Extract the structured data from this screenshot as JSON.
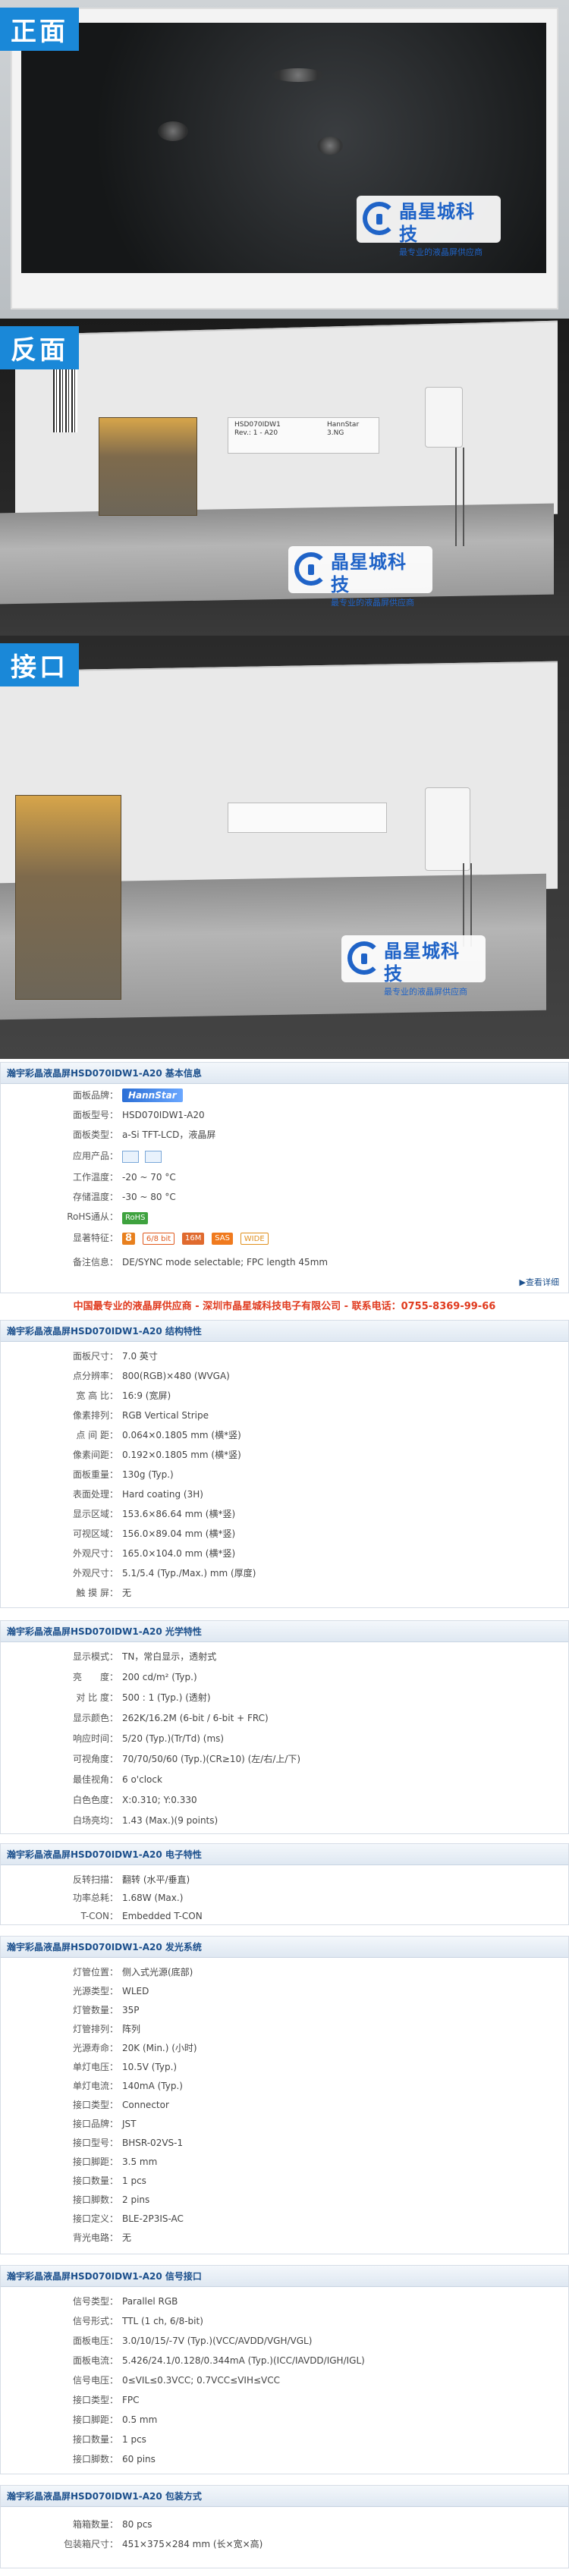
{
  "photos": {
    "front": {
      "tag": "正面"
    },
    "back": {
      "tag": "反面",
      "sticker_lines": [
        "HSD070IDW1",
        "Rev.: 1 - A20",
        "HannStar",
        "3.NG"
      ]
    },
    "port": {
      "tag": "接口"
    }
  },
  "logo": {
    "name": "晶星城科技",
    "slogan": "最专业的液晶屏供应商"
  },
  "basic": {
    "title": "瀚宇彩晶液晶屏HSD070IDW1-A20 基本信息",
    "brand_label": "面板品牌：",
    "brand_value": "HannStar",
    "model_label": "面板型号：",
    "model_value": "HSD070IDW1-A20",
    "type_label": "面板类型：",
    "type_value": "a-Si TFT-LCD，液晶屏",
    "app_label": "应用产品：",
    "optemp_label": "工作温度：",
    "optemp_value": "-20 ~ 70 °C",
    "sttemp_label": "存储温度：",
    "sttemp_value": "-30 ~ 80 °C",
    "rohs_label": "RoHS通从：",
    "rohs_value": "RoHS",
    "feature_label": "显著特征：",
    "features": [
      "8",
      "6/8 bit",
      "16M",
      "SAS",
      "WIDE"
    ],
    "remark_label": "备注信息：",
    "remark_value": "DE/SYNC mode selectable; FPC length 45mm",
    "more_link": "▶查看详细"
  },
  "banner": "中国最专业的液晶屏供应商 - 深圳市晶星城科技电子有限公司 - 联系电话：0755-8369-99-66",
  "structure": {
    "title": "瀚宇彩晶液晶屏HSD070IDW1-A20 结构特性",
    "rows": [
      [
        "面板尺寸：",
        "7.0 英寸"
      ],
      [
        "点分辨率：",
        "800(RGB)×480 (WVGA)"
      ],
      [
        "宽 高 比：",
        "16:9 (宽屏)"
      ],
      [
        "像素排列：",
        "RGB Vertical Stripe"
      ],
      [
        "点 间 距：",
        "0.064×0.1805 mm (横*竖)"
      ],
      [
        "像素间距：",
        "0.192×0.1805 mm (横*竖)"
      ],
      [
        "面板重量：",
        "130g (Typ.)"
      ],
      [
        "表面处理：",
        "Hard coating (3H)"
      ],
      [
        "显示区域：",
        "153.6×86.64 mm (横*竖)"
      ],
      [
        "可视区域：",
        "156.0×89.04 mm (横*竖)"
      ],
      [
        "外观尺寸：",
        "165.0×104.0 mm (横*竖)"
      ],
      [
        "外观尺寸：",
        "5.1/5.4 (Typ./Max.) mm (厚度)"
      ],
      [
        "触 摸 屏：",
        "无"
      ]
    ]
  },
  "optical": {
    "title": "瀚宇彩晶液晶屏HSD070IDW1-A20 光学特性",
    "rows": [
      [
        "显示模式：",
        "TN，常白显示，透射式"
      ],
      [
        "亮　　度：",
        "200 cd/m² (Typ.)"
      ],
      [
        "对 比 度：",
        "500 : 1 (Typ.) (透射)"
      ],
      [
        "显示颜色：",
        "262K/16.2M (6-bit / 6-bit + FRC)"
      ],
      [
        "响应时间：",
        "5/20 (Typ.)(Tr/Td) (ms)"
      ],
      [
        "可视角度：",
        "70/70/50/60 (Typ.)(CR≥10) (左/右/上/下)"
      ],
      [
        "最佳视角：",
        "6 o'clock"
      ],
      [
        "白色色度：",
        "X:0.310; Y:0.330"
      ],
      [
        "白场亮均：",
        "1.43 (Max.)(9 points)"
      ]
    ]
  },
  "electrical": {
    "title": "瀚宇彩晶液晶屏HSD070IDW1-A20 电子特性",
    "rows": [
      [
        "反转扫描：",
        "翻转 (水平/垂直)"
      ],
      [
        "功率总耗：",
        "1.68W (Max.)"
      ],
      [
        "T-CON：",
        "Embedded T-CON"
      ]
    ]
  },
  "backlight": {
    "title": "瀚宇彩晶液晶屏HSD070IDW1-A20 发光系统",
    "rows": [
      [
        "灯管位置：",
        "侧入式光源(底部)"
      ],
      [
        "光源类型：",
        "WLED"
      ],
      [
        "灯管数量：",
        "35P"
      ],
      [
        "灯管排列：",
        "阵列"
      ],
      [
        "光源寿命：",
        "20K (Min.) (小时)"
      ],
      [
        "单灯电压：",
        "10.5V (Typ.)"
      ],
      [
        "单灯电流：",
        "140mA (Typ.)"
      ],
      [
        "接口类型：",
        "Connector"
      ],
      [
        "接口品牌：",
        "JST"
      ],
      [
        "接口型号：",
        "BHSR-02VS-1"
      ],
      [
        "接口脚距：",
        "3.5 mm"
      ],
      [
        "接口数量：",
        "1 pcs"
      ],
      [
        "接口脚数：",
        "2 pins"
      ],
      [
        "接口定义：",
        "BLE-2P3IS-AC"
      ],
      [
        "背光电路：",
        "无"
      ]
    ]
  },
  "signal": {
    "title": "瀚宇彩晶液晶屏HSD070IDW1-A20 信号接口",
    "rows": [
      [
        "信号类型：",
        "Parallel RGB"
      ],
      [
        "信号形式：",
        "TTL (1 ch, 6/8-bit)"
      ],
      [
        "面板电压：",
        "3.0/10/15/-7V (Typ.)(VCC/AVDD/VGH/VGL)"
      ],
      [
        "面板电流：",
        "5.426/24.1/0.128/0.344mA (Typ.)(ICC/IAVDD/IGH/IGL)"
      ],
      [
        "信号电压：",
        "0≤VIL≤0.3VCC; 0.7VCC≤VIH≤VCC"
      ],
      [
        "接口类型：",
        "FPC"
      ],
      [
        "接口脚距：",
        "0.5 mm"
      ],
      [
        "接口数量：",
        "1 pcs"
      ],
      [
        "接口脚数：",
        "60 pins"
      ]
    ]
  },
  "package": {
    "title": "瀚宇彩晶液晶屏HSD070IDW1-A20 包装方式",
    "rows": [
      [
        "箱箱数量：",
        "80 pcs"
      ],
      [
        "包装箱尺寸：",
        "451×375×284 mm (长×宽×高)"
      ]
    ]
  }
}
